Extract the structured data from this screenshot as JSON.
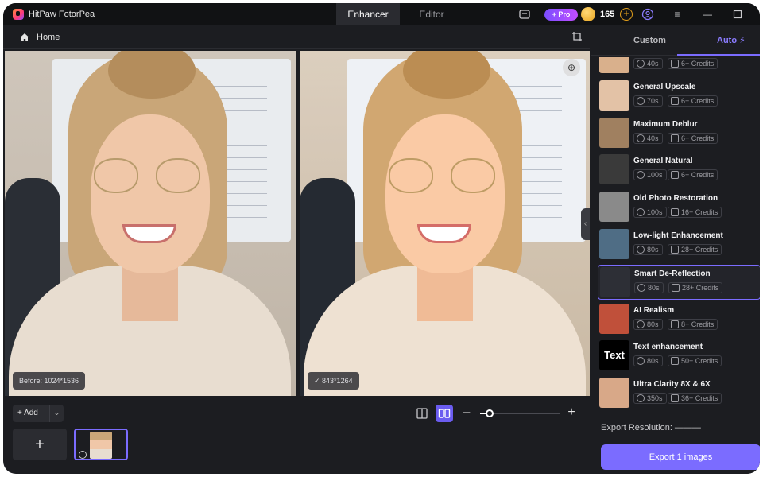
{
  "app": {
    "title": "HitPaw FotorPea"
  },
  "mode_tabs": [
    {
      "label": "Enhancer",
      "active": true
    },
    {
      "label": "Editor",
      "active": false
    }
  ],
  "header": {
    "pro_label": "+ Pro",
    "credits": "165"
  },
  "breadcrumb": {
    "home_label": "Home"
  },
  "preview": {
    "before_label": "Before: 1024*1536",
    "after_label": "✓  843*1264"
  },
  "toolbar": {
    "add_label": "+ Add",
    "add_chevron": "⌄",
    "add_tile": "+",
    "zoom_level": 0.12
  },
  "sidebar": {
    "tabs": [
      {
        "label": "Custom"
      },
      {
        "label": "Auto ⚡"
      }
    ],
    "models": [
      {
        "name": "",
        "time": "40s",
        "credits": "6+ Credits",
        "thumb": "#d9b08c"
      },
      {
        "name": "General Upscale",
        "time": "70s",
        "credits": "6+ Credits",
        "thumb": "#e3c2a6"
      },
      {
        "name": "Maximum Deblur",
        "time": "40s",
        "credits": "6+ Credits",
        "thumb": "#a08060"
      },
      {
        "name": "General Natural",
        "time": "100s",
        "credits": "6+ Credits",
        "thumb": "#3a3a3a"
      },
      {
        "name": "Old Photo Restoration",
        "time": "100s",
        "credits": "16+ Credits",
        "thumb": "#8a8a8a"
      },
      {
        "name": "Low-light Enhancement",
        "time": "80s",
        "credits": "28+ Credits",
        "thumb": "#4f6d85"
      },
      {
        "name": "Smart De-Reflection",
        "time": "80s",
        "credits": "28+ Credits",
        "thumb": "#2d2f36",
        "selected": true
      },
      {
        "name": "AI Realism",
        "time": "80s",
        "credits": "8+ Credits",
        "thumb": "#c0503a"
      },
      {
        "name": "Text enhancement",
        "time": "80s",
        "credits": "50+ Credits",
        "thumb": "#000000",
        "thumb_text": "Text"
      },
      {
        "name": "Ultra Clarity 8X & 6X",
        "time": "350s",
        "credits": "36+ Credits",
        "thumb": "#d8a888"
      }
    ],
    "export_resolution": "Export Resolution:  ———",
    "export_button": "Export 1 images"
  },
  "colors": {
    "accent": "#7b6cff",
    "background": "#1c1d21",
    "titlebar": "#111214"
  }
}
